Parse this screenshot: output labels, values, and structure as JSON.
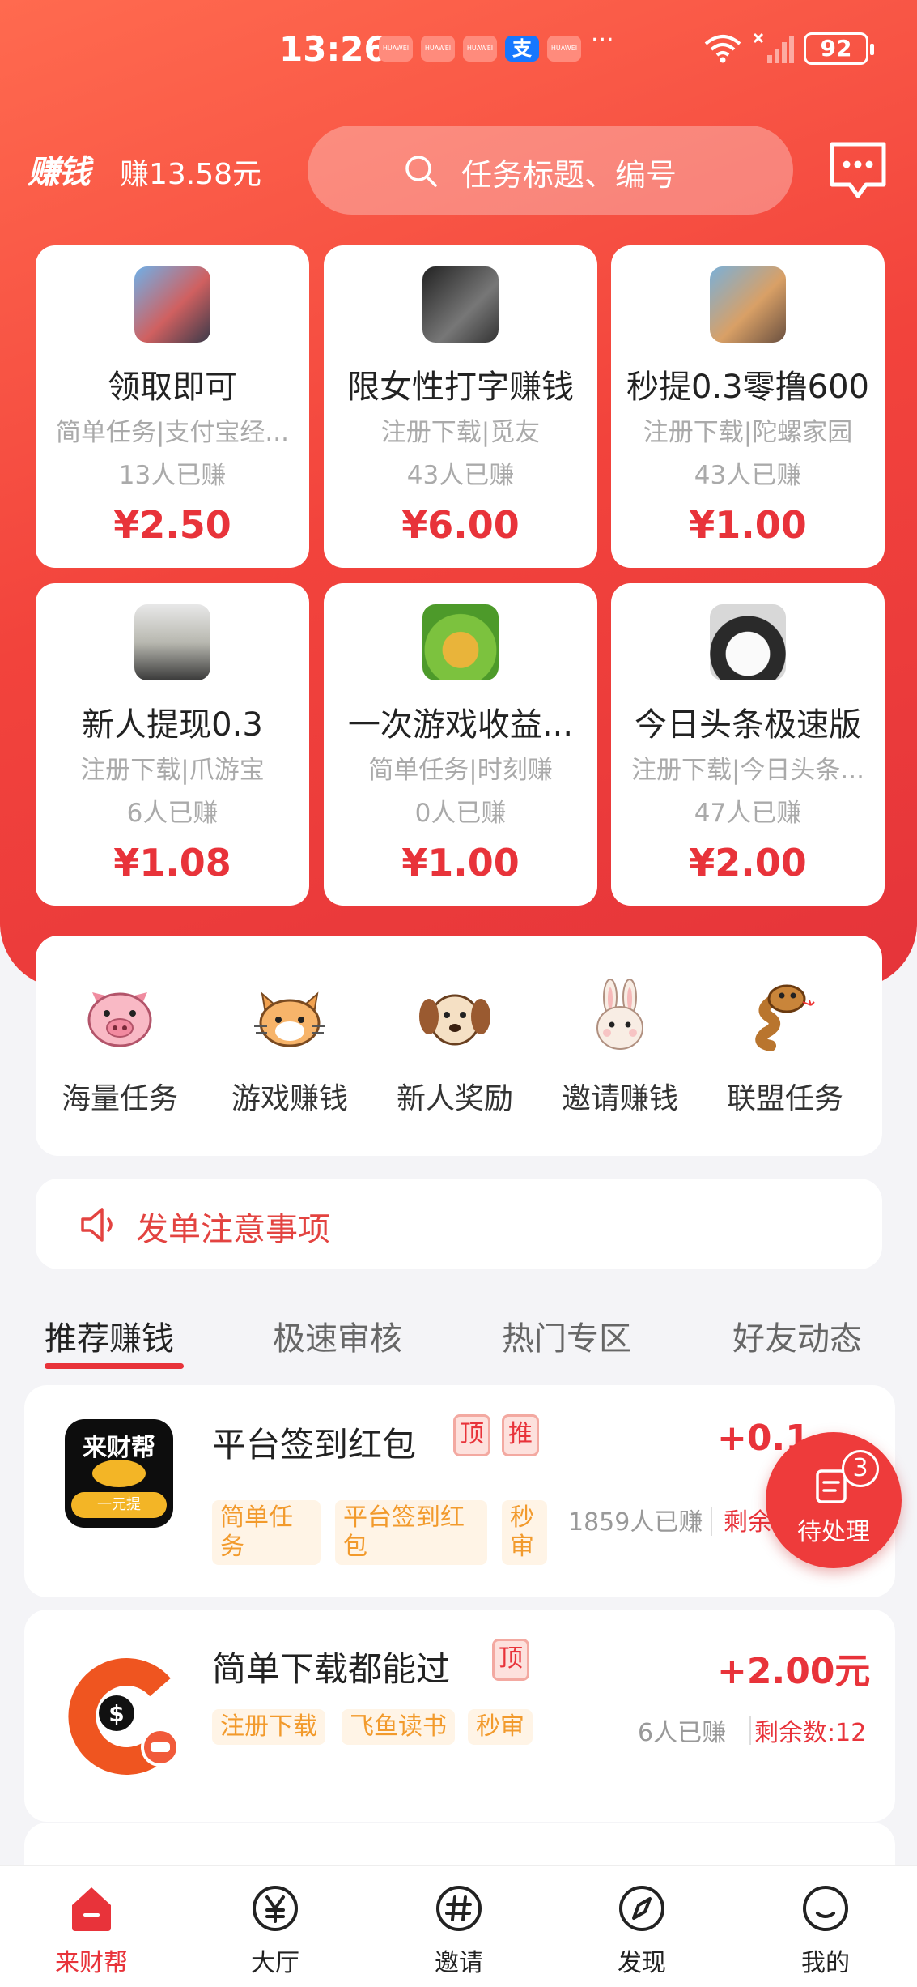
{
  "status_bar": {
    "time": "13:26",
    "notification_icons": [
      "HUAWEI",
      "HUAWEI",
      "HUAWEI",
      "支",
      "HUAWEI"
    ],
    "more": "···",
    "battery": "92"
  },
  "header": {
    "brand": "赚钱",
    "earned": "赚13.58元",
    "search_placeholder": "任务标题、编号"
  },
  "featured_tasks": [
    {
      "title": "领取即可",
      "subtitle": "简单任务|支付宝经...",
      "count": "13人已赚",
      "price": "¥2.50"
    },
    {
      "title": "限女性打字赚钱",
      "subtitle": "注册下载|觅友",
      "count": "43人已赚",
      "price": "¥6.00"
    },
    {
      "title": "秒提0.3零撸600",
      "subtitle": "注册下载|陀螺家园",
      "count": "43人已赚",
      "price": "¥1.00"
    },
    {
      "title": "新人提现0.3",
      "subtitle": "注册下载|爪游宝",
      "count": "6人已赚",
      "price": "¥1.08"
    },
    {
      "title": "一次游戏收益...",
      "subtitle": "简单任务|时刻赚",
      "count": "0人已赚",
      "price": "¥1.00"
    },
    {
      "title": "今日头条极速版",
      "subtitle": "注册下载|今日头条...",
      "count": "47人已赚",
      "price": "¥2.00"
    }
  ],
  "categories": [
    {
      "label": "海量任务",
      "icon": "pig-icon"
    },
    {
      "label": "游戏赚钱",
      "icon": "cat-icon"
    },
    {
      "label": "新人奖励",
      "icon": "dog-icon"
    },
    {
      "label": "邀请赚钱",
      "icon": "rabbit-icon"
    },
    {
      "label": "联盟任务",
      "icon": "snake-icon"
    }
  ],
  "notice": "发单注意事项",
  "tabs": [
    "推荐赚钱",
    "极速审核",
    "热门专区",
    "好友动态"
  ],
  "active_tab": 0,
  "task_list": [
    {
      "logo_text": "来财帮",
      "logo_sub": "一元提",
      "name": "平台签到红包",
      "badges": [
        "顶",
        "推"
      ],
      "tags": [
        "简单任务",
        "平台签到红包",
        "秒审"
      ],
      "reward": "+0.1",
      "done": "1859人已赚",
      "remain": "剩余"
    },
    {
      "name": "简单下载都能过",
      "badges": [
        "顶"
      ],
      "tags": [
        "注册下载",
        "飞鱼读书",
        "秒审"
      ],
      "reward": "+2.00元",
      "done": "6人已赚",
      "remain": "剩余数:12"
    }
  ],
  "pending": {
    "count": "3",
    "label": "待处理"
  },
  "bottom_nav": [
    {
      "label": "来财帮",
      "icon": "home-icon",
      "active": true
    },
    {
      "label": "大厅",
      "icon": "yuan-icon",
      "active": false
    },
    {
      "label": "邀请",
      "icon": "hashtag-icon",
      "active": false
    },
    {
      "label": "发现",
      "icon": "compass-icon",
      "active": false
    },
    {
      "label": "我的",
      "icon": "smile-icon",
      "active": false
    }
  ],
  "colors": {
    "primary": "#e8333a",
    "gradient_start": "#ff6a4f",
    "tag_text": "#f29a2c"
  }
}
